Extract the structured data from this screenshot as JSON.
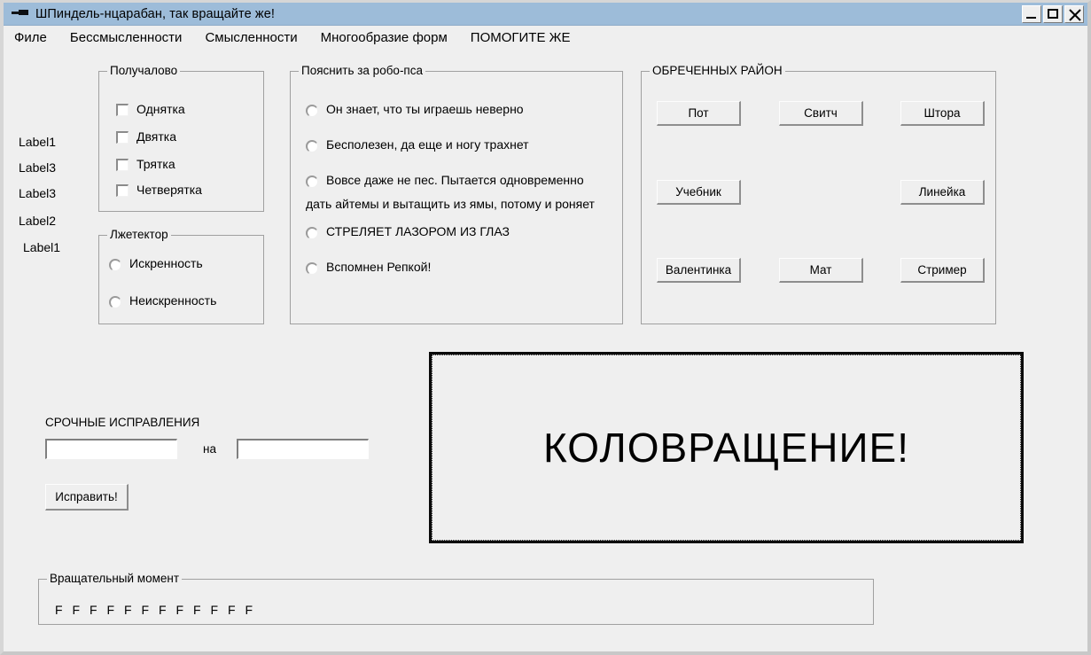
{
  "window": {
    "title": "ШПиндель-нцарабан, так вращайте же!",
    "icon": "spindle-icon",
    "controls": {
      "minimize": "minimize-icon",
      "maximize": "maximize-icon",
      "close": "close-icon"
    }
  },
  "menubar": {
    "items": [
      "Филе",
      "Бессмысленности",
      "Смысленности",
      "Многообразие форм",
      "ПОМОГИТЕ ЖЕ"
    ]
  },
  "side_labels": [
    "Label1",
    "Label3",
    "Label3",
    "Label2",
    "Label1"
  ],
  "group_poluchalovo": {
    "title": "Получалово",
    "checkboxes": [
      {
        "label": "Однятка",
        "checked": false
      },
      {
        "label": "Двятка",
        "checked": false
      },
      {
        "label": "Трятка",
        "checked": false
      },
      {
        "label": "Четверятка",
        "checked": false
      }
    ]
  },
  "group_lzhetektor": {
    "title": "Лжетектор",
    "radios": [
      {
        "label": "Искренность",
        "selected": false
      },
      {
        "label": "Неискренность",
        "selected": false
      }
    ]
  },
  "group_robopes": {
    "title": "Пояснить за робо-пса",
    "radios": [
      {
        "label": "Он знает, что ты играешь неверно",
        "selected": false
      },
      {
        "label": "Бесполезен, да еще и ногу трахнет",
        "selected": false
      },
      {
        "label": "Вовсе даже не пес. Пытается одновременно",
        "selected": false
      },
      {
        "label": "СТРЕЛЯЕТ ЛАЗОРОМ ИЗ ГЛАЗ",
        "selected": false
      },
      {
        "label": "Вспомнен Репкой!",
        "selected": false
      }
    ],
    "wrapped_line": "дать айтемы и вытащить из ямы, потому и роняет"
  },
  "group_obrechennyh": {
    "title": "ОБРЕЧЕННЫХ РАЙОН",
    "buttons": [
      "Пот",
      "Свитч",
      "Штора",
      "Учебник",
      "Линейка",
      "Валентинка",
      "Мат",
      "Стример"
    ]
  },
  "corrections": {
    "caption": "СРОЧНЫЕ ИСПРАВЛЕНИЯ",
    "field_from": "",
    "field_from_placeholder": "",
    "separator": "на",
    "field_to": "",
    "field_to_placeholder": "",
    "apply_button": "Исправить!"
  },
  "display": {
    "text": "КОЛОВРАЩЕНИЕ!"
  },
  "group_torque": {
    "title": "Вращательный момент",
    "items": [
      "F",
      "F",
      "F",
      "F",
      "F",
      "F",
      "F",
      "F",
      "F",
      "F",
      "F",
      "F"
    ]
  }
}
